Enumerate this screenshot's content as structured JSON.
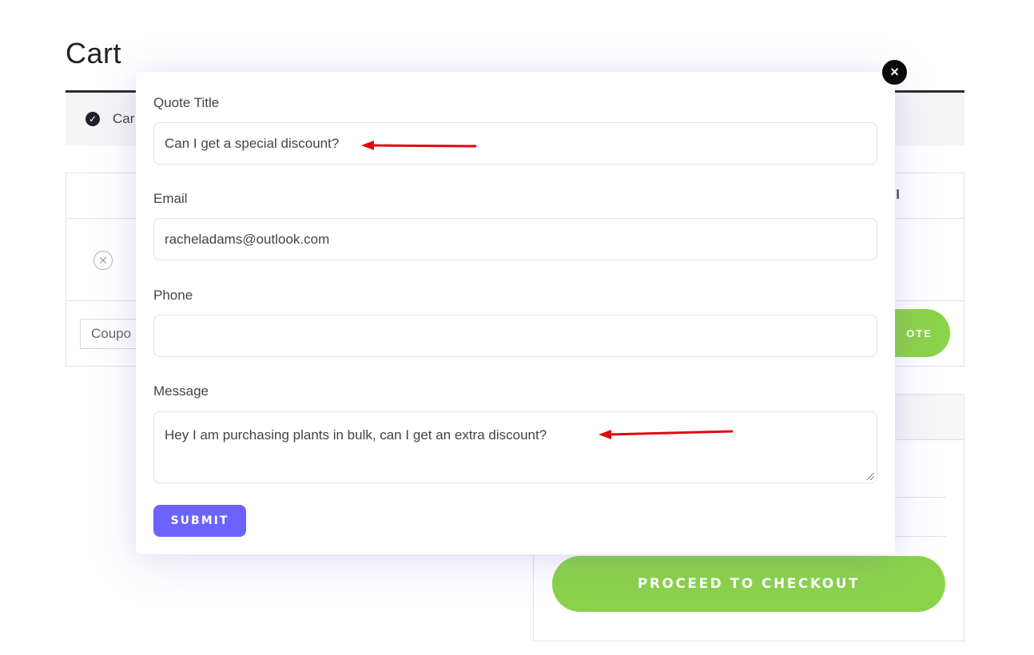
{
  "page": {
    "title": "Cart",
    "notice_text": "Car",
    "table_header_total": "l",
    "coupon_placeholder": "Coupo",
    "update_button_label": "OTE",
    "checkout_button_label": "PROCEED TO CHECKOUT"
  },
  "modal": {
    "close_label": "×",
    "fields": {
      "quote_title": {
        "label": "Quote Title",
        "value": "Can I get a special discount?"
      },
      "email": {
        "label": "Email",
        "value": "racheladams@outlook.com"
      },
      "phone": {
        "label": "Phone",
        "value": ""
      },
      "message": {
        "label": "Message",
        "value": "Hey I am purchasing plants in bulk, can I get an extra discount?"
      }
    },
    "submit_label": "SUBMIT"
  },
  "icons": {
    "notice": "check-circle-icon",
    "remove": "remove-circle-icon",
    "close": "close-icon",
    "annotation": "red-arrow-icon"
  },
  "colors": {
    "accent_green": "#8bd34a",
    "submit_purple": "#6c63ff",
    "annotation_red": "#e30613"
  }
}
